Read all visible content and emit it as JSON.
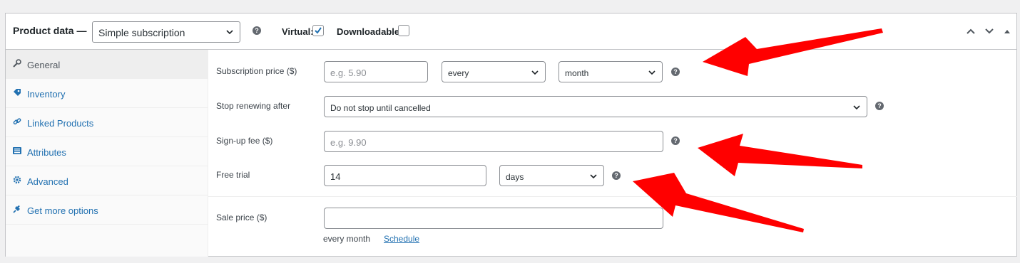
{
  "header": {
    "title": "Product data —",
    "product_type": "Simple subscription",
    "virtual_label": "Virtual:",
    "virtual_checked": true,
    "downloadable_label": "Downloadable:",
    "downloadable_checked": false
  },
  "tabs": [
    {
      "label": "General",
      "icon": "wrench-icon",
      "active": true
    },
    {
      "label": "Inventory",
      "icon": "tag-icon",
      "active": false
    },
    {
      "label": "Linked Products",
      "icon": "link-icon",
      "active": false
    },
    {
      "label": "Attributes",
      "icon": "list-icon",
      "active": false
    },
    {
      "label": "Advanced",
      "icon": "gear-icon",
      "active": false
    },
    {
      "label": "Get more options",
      "icon": "plugin-icon",
      "active": false
    }
  ],
  "fields": {
    "subscription_price": {
      "label": "Subscription price ($)",
      "placeholder": "e.g. 5.90",
      "interval": "every",
      "period": "month"
    },
    "stop_renewing": {
      "label": "Stop renewing after",
      "value": "Do not stop until cancelled"
    },
    "signup_fee": {
      "label": "Sign-up fee ($)",
      "placeholder": "e.g. 9.90"
    },
    "free_trial": {
      "label": "Free trial",
      "value": "14",
      "period": "days"
    },
    "sale_price": {
      "label": "Sale price ($)",
      "value": "",
      "note": "every month",
      "schedule_label": "Schedule"
    }
  },
  "help_glyph": "?",
  "colors": {
    "link": "#2271b1",
    "arrow": "#ff0000",
    "border": "#c3c4c7"
  }
}
